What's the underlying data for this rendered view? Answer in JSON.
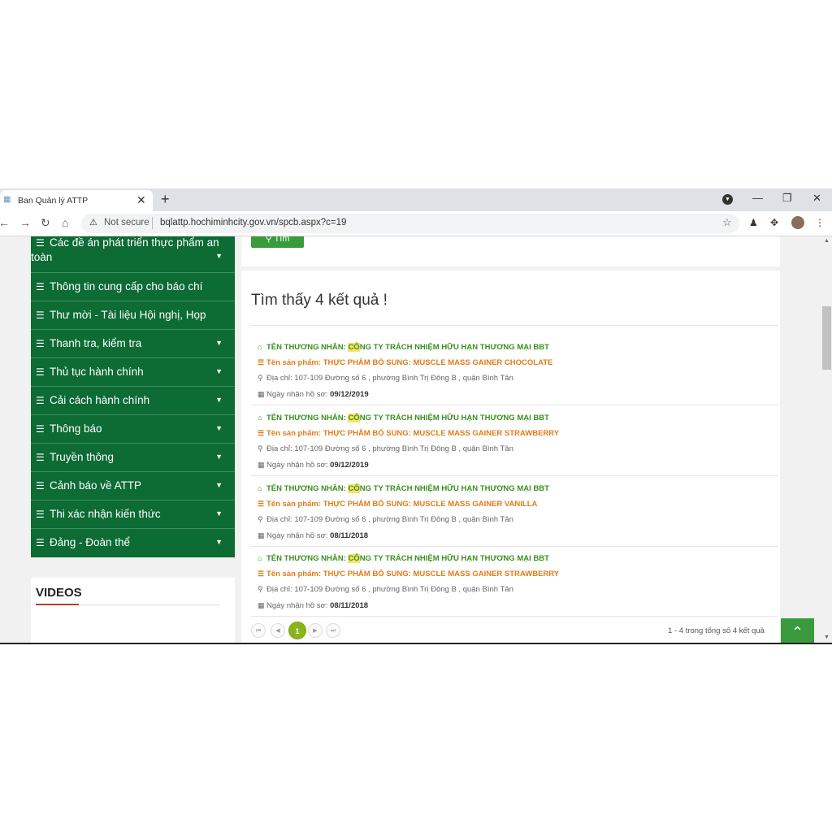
{
  "tab": {
    "title": "Ban Quản lý ATTP",
    "close": "✕",
    "new": "+"
  },
  "window": {
    "minimize": "—",
    "restore": "❐",
    "close": "✕"
  },
  "toolbar": {
    "back": "←",
    "forward": "→",
    "reload": "↻",
    "home": "⌂",
    "security_label": "Not secure",
    "url": "bqlattp.hochiminhcity.gov.vn/spcb.aspx?c=19",
    "menu": "⋮"
  },
  "sidebar": {
    "items": [
      {
        "label": "Các đề án phát triển thực phẩm an toàn",
        "line1": "Các đề án phát triển thực phẩm an",
        "line2": "toàn",
        "dropdown": true
      },
      {
        "label": "Thông tin cung cấp cho báo chí",
        "dropdown": false
      },
      {
        "label": "Thư mời - Tài liệu Hội nghị, Họp",
        "dropdown": false
      },
      {
        "label": "Thanh tra, kiểm tra",
        "dropdown": true
      },
      {
        "label": "Thủ tục hành chính",
        "dropdown": true
      },
      {
        "label": "Cải cách hành chính",
        "dropdown": true
      },
      {
        "label": "Thông báo",
        "dropdown": true
      },
      {
        "label": "Truyền thông",
        "dropdown": true
      },
      {
        "label": "Cảnh báo về ATTP",
        "dropdown": true
      },
      {
        "label": "Thi xác nhận kiến thức",
        "dropdown": true
      },
      {
        "label": "Đảng - Đoàn thể",
        "dropdown": true
      }
    ],
    "videos_title": "VIDEOS"
  },
  "search": {
    "button_label": "Tìm"
  },
  "results": {
    "heading": "Tìm thấy 4 kết quả !",
    "merchant_label": "TÊN THƯƠNG NHÂN:",
    "product_label": "Tên sản phẩm:",
    "address_label": "Địa chỉ:",
    "date_label": "Ngày nhận hồ sơ:",
    "items": [
      {
        "merchant_hl": "CÔ",
        "merchant_rest": "NG TY TRÁCH NHIỆM HỮU HẠN THƯƠNG MẠI BBT",
        "product": "THỰC PHẨM BỔ SUNG: MUSCLE MASS GAINER CHOCOLATE",
        "address": "107-109 Đường số 6 , phường Bình Trị Đông B , quận Bình Tân",
        "date": "09/12/2019"
      },
      {
        "merchant_hl": "CÔ",
        "merchant_rest": "NG TY TRÁCH NHIỆM HỮU HẠN THƯƠNG MẠI BBT",
        "product": "THỰC PHẨM BỔ SUNG: MUSCLE MASS GAINER STRAWBERRY",
        "address": "107-109 Đường số 6 , phường Bình Trị Đông B , quận Bình Tân",
        "date": "09/12/2019"
      },
      {
        "merchant_hl": "CÔ",
        "merchant_rest": "NG TY TRÁCH NHIỆM HỮU HẠN THƯƠNG MẠI BBT",
        "product": "THỰC PHẨM BỔ SUNG: MUSCLE MASS GAINER VANILLA",
        "address": "107-109 Đường số 6 , phường Bình Trị Đông B , quận Bình Tân",
        "date": "08/11/2018"
      },
      {
        "merchant_hl": "CÔ",
        "merchant_rest": "NG TY TRÁCH NHIỆM HỮU HẠN THƯƠNG MẠI BBT",
        "product": "THỰC PHẨM BỔ SUNG: MUSCLE MASS GAINER STRAWBERRY",
        "address": "107-109 Đường số 6 , phường Bình Trị Đông B , quận Bình Tân",
        "date": "08/11/2018"
      }
    ]
  },
  "pagination": {
    "first": "⏮",
    "prev": "◀",
    "current": "1",
    "next": "▶",
    "last": "⏭",
    "info": "1 - 4 trong tổng số 4 kết quả"
  },
  "scroll_top": "⌃",
  "colors": {
    "menu_green": "#0d6b34",
    "button_green": "#3a9a3e",
    "merchant_green": "#3b8f1f",
    "product_orange": "#e07b1a",
    "page_active": "#8bb31d"
  }
}
